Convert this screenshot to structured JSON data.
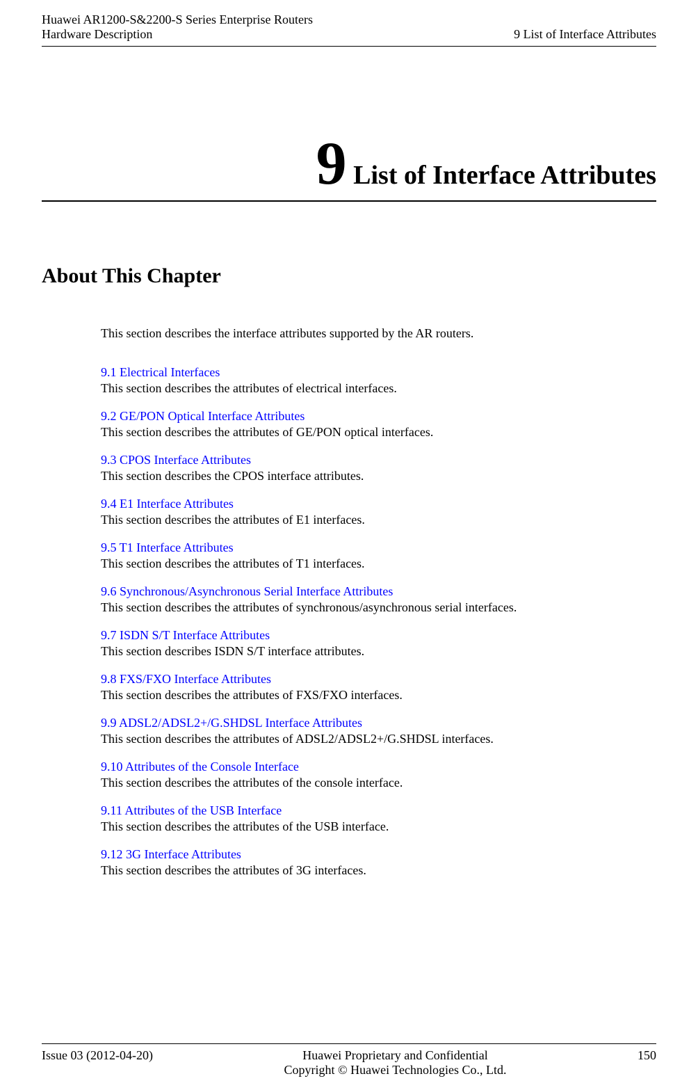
{
  "header": {
    "product_line1": "Huawei AR1200-S&2200-S Series Enterprise Routers",
    "product_line2": "Hardware Description",
    "chapter_ref": "9 List of Interface Attributes"
  },
  "chapter": {
    "number": "9",
    "title": "List of Interface Attributes"
  },
  "about_heading": "About This Chapter",
  "intro": "This section describes the interface attributes supported by the AR routers.",
  "sections": [
    {
      "link": "9.1 Electrical Interfaces",
      "desc": "This section describes the attributes of electrical interfaces."
    },
    {
      "link": "9.2 GE/PON Optical Interface Attributes",
      "desc": "This section describes the attributes of GE/PON optical interfaces."
    },
    {
      "link": "9.3 CPOS Interface Attributes",
      "desc": "This section describes the CPOS interface attributes."
    },
    {
      "link": "9.4 E1 Interface Attributes",
      "desc": "This section describes the attributes of E1 interfaces."
    },
    {
      "link": "9.5 T1 Interface Attributes",
      "desc": "This section describes the attributes of T1 interfaces."
    },
    {
      "link": "9.6 Synchronous/Asynchronous Serial Interface Attributes",
      "desc": "This section describes the attributes of synchronous/asynchronous serial interfaces."
    },
    {
      "link": "9.7 ISDN S/T Interface Attributes",
      "desc": "This section describes ISDN S/T interface attributes."
    },
    {
      "link": "9.8 FXS/FXO Interface Attributes",
      "desc": "This section describes the attributes of FXS/FXO interfaces."
    },
    {
      "link": "9.9 ADSL2/ADSL2+/G.SHDSL Interface Attributes",
      "desc": "This section describes the attributes of ADSL2/ADSL2+/G.SHDSL interfaces."
    },
    {
      "link": "9.10 Attributes of the Console Interface",
      "desc": "This section describes the attributes of the console interface."
    },
    {
      "link": "9.11 Attributes of the USB Interface",
      "desc": "This section describes the attributes of the USB interface."
    },
    {
      "link": "9.12 3G Interface Attributes",
      "desc": "This section describes the attributes of 3G interfaces."
    }
  ],
  "footer": {
    "issue": "Issue 03 (2012-04-20)",
    "center_line1": "Huawei Proprietary and Confidential",
    "center_line2": "Copyright © Huawei Technologies Co., Ltd.",
    "page": "150"
  }
}
